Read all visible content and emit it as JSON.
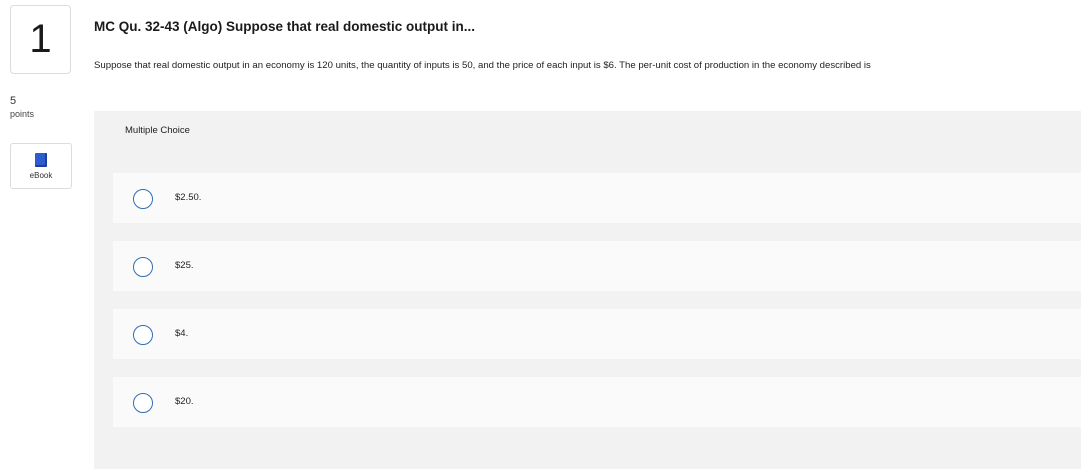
{
  "question": {
    "number": "1",
    "points_value": "5",
    "points_label": "points",
    "ebook_label": "eBook",
    "title": "MC Qu. 32-43 (Algo) Suppose that real domestic output in...",
    "prompt": "Suppose that real domestic output in an economy is 120 units, the quantity of inputs is 50, and the price of each input is $6. The per-unit cost of production in the economy described is"
  },
  "multiple_choice": {
    "header": "Multiple Choice",
    "options": [
      {
        "label": "$2.50."
      },
      {
        "label": "$25."
      },
      {
        "label": "$4."
      },
      {
        "label": "$20."
      }
    ]
  },
  "colors": {
    "radio_border": "#2f6db5",
    "panel_bg": "#f2f2f2",
    "choice_bg": "#fafafa",
    "ebook_icon": "#2f5bd1"
  }
}
